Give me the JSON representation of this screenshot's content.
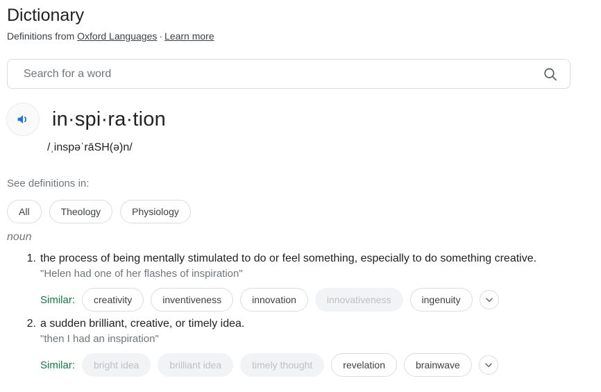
{
  "header": {
    "title": "Dictionary",
    "attribution_prefix": "Definitions from",
    "source_link": "Oxford Languages",
    "separator": "·",
    "learn_more": "Learn more"
  },
  "search": {
    "placeholder": "Search for a word",
    "value": "",
    "icon": "search-icon"
  },
  "entry": {
    "audio_icon": "speaker-icon",
    "headword": "in·spi·ra·tion",
    "phonetic": "/ˌinspəˈrāSH(ə)n/",
    "see_definitions_in_label": "See definitions in:",
    "categories": [
      {
        "label": "All",
        "selected": true
      },
      {
        "label": "Theology",
        "selected": false
      },
      {
        "label": "Physiology",
        "selected": false
      }
    ],
    "part_of_speech": "noun",
    "definitions": [
      {
        "number": "1.",
        "text": "the process of being mentally stimulated to do or feel something, especially to do something creative.",
        "example": "\"Helen had one of her flashes of inspiration\"",
        "similar_label": "Similar:",
        "similar": [
          {
            "label": "creativity",
            "faded": false
          },
          {
            "label": "inventiveness",
            "faded": false
          },
          {
            "label": "innovation",
            "faded": false
          },
          {
            "label": "innovativeness",
            "faded": true
          },
          {
            "label": "ingenuity",
            "faded": false
          }
        ],
        "expand_icon": "chevron-down-icon"
      },
      {
        "number": "2.",
        "text": "a sudden brilliant, creative, or timely idea.",
        "example": "\"then I had an inspiration\"",
        "similar_label": "Similar:",
        "similar": [
          {
            "label": "bright idea",
            "faded": true
          },
          {
            "label": "brilliant idea",
            "faded": true
          },
          {
            "label": "timely thought",
            "faded": true
          },
          {
            "label": "revelation",
            "faded": false
          },
          {
            "label": "brainwave",
            "faded": false
          }
        ],
        "expand_icon": "chevron-down-icon"
      }
    ]
  },
  "colors": {
    "text_primary": "#202124",
    "text_secondary": "#70757a",
    "link": "#3c4043",
    "accent_blue": "#1a73e8",
    "similar_green": "#0b8043",
    "chip_border": "#dadce0",
    "chip_faded_bg": "#f1f3f4",
    "chip_faded_text": "#bdc1c6"
  }
}
